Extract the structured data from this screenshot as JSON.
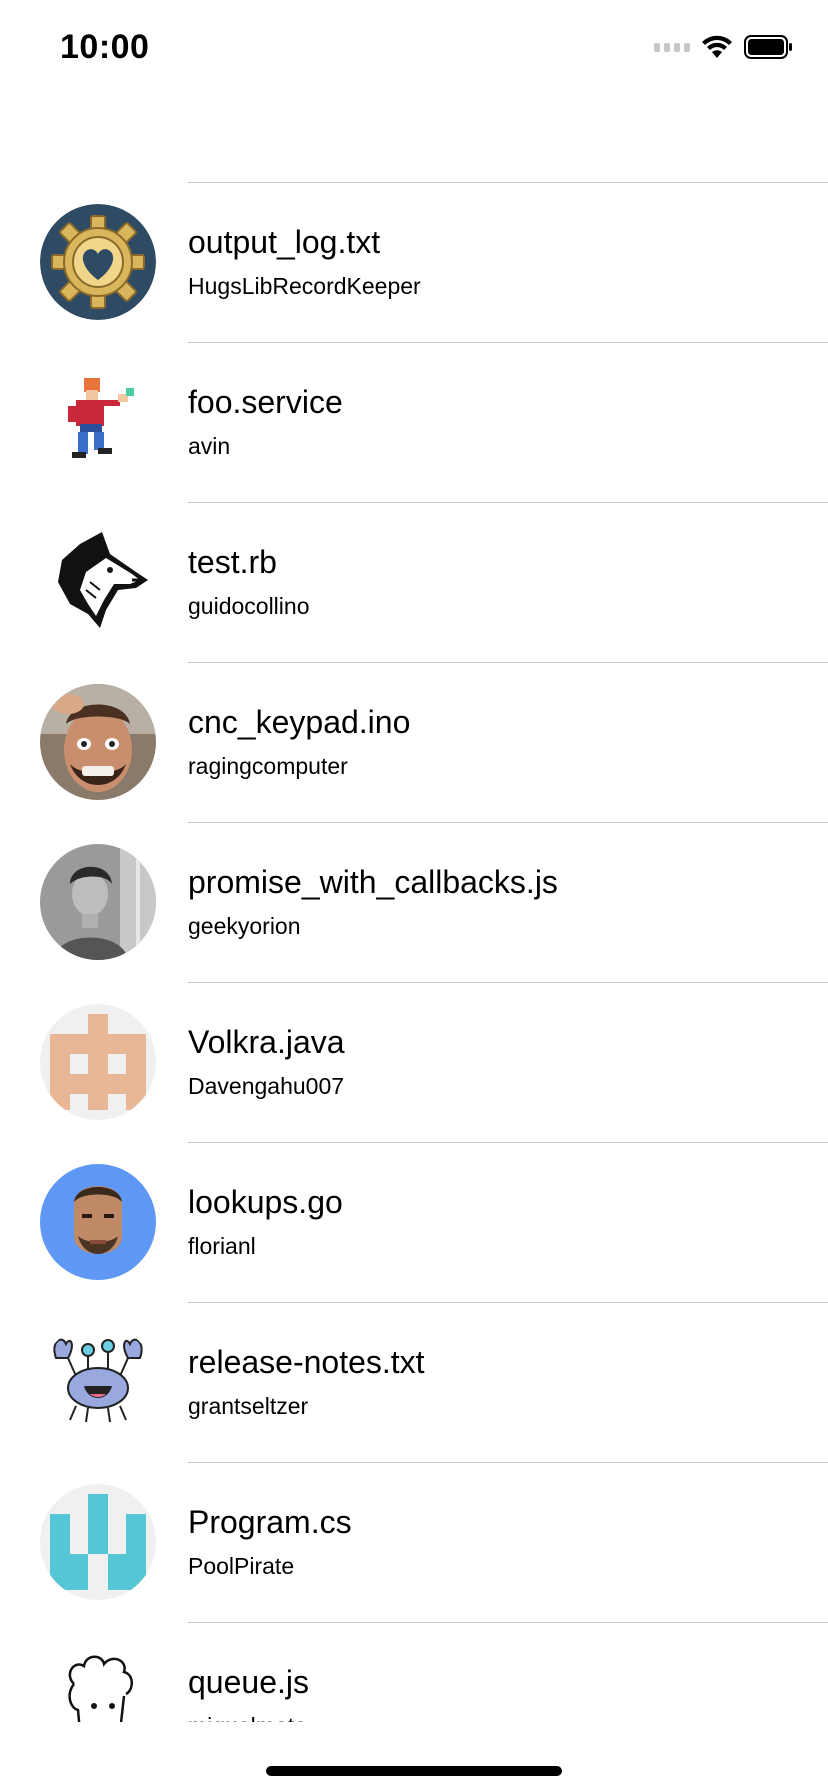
{
  "status_bar": {
    "time": "10:00",
    "signal_icon": "signal-icon",
    "wifi_icon": "wifi-icon",
    "battery_icon": "battery-icon"
  },
  "items": [
    {
      "title": "output_log.txt",
      "subtitle": "HugsLibRecordKeeper",
      "avatar": "gear-heart-icon"
    },
    {
      "title": "foo.service",
      "subtitle": "avin",
      "avatar": "pixel-character-avatar"
    },
    {
      "title": "test.rb",
      "subtitle": "guidocollino",
      "avatar": "wolf-avatar"
    },
    {
      "title": "cnc_keypad.ino",
      "subtitle": "ragingcomputer",
      "avatar": "photo-avatar"
    },
    {
      "title": "promise_with_callbacks.js",
      "subtitle": "geekyorion",
      "avatar": "photo-avatar"
    },
    {
      "title": "Volkra.java",
      "subtitle": "Davengahu007",
      "avatar": "identicon-avatar"
    },
    {
      "title": "lookups.go",
      "subtitle": "florianl",
      "avatar": "photo-avatar"
    },
    {
      "title": "release-notes.txt",
      "subtitle": "grantseltzer",
      "avatar": "crab-avatar"
    },
    {
      "title": "Program.cs",
      "subtitle": "PoolPirate",
      "avatar": "identicon-avatar"
    },
    {
      "title": "queue.js",
      "subtitle": "miguelmota",
      "avatar": "sketch-face-avatar"
    }
  ],
  "colors": {
    "divider": "#c8c7cc",
    "avatar_dark_blue": "#2f4a63",
    "avatar_blue": "#5f97f5",
    "identicon_peach": "#e8b896",
    "identicon_teal": "#55c6d3"
  }
}
